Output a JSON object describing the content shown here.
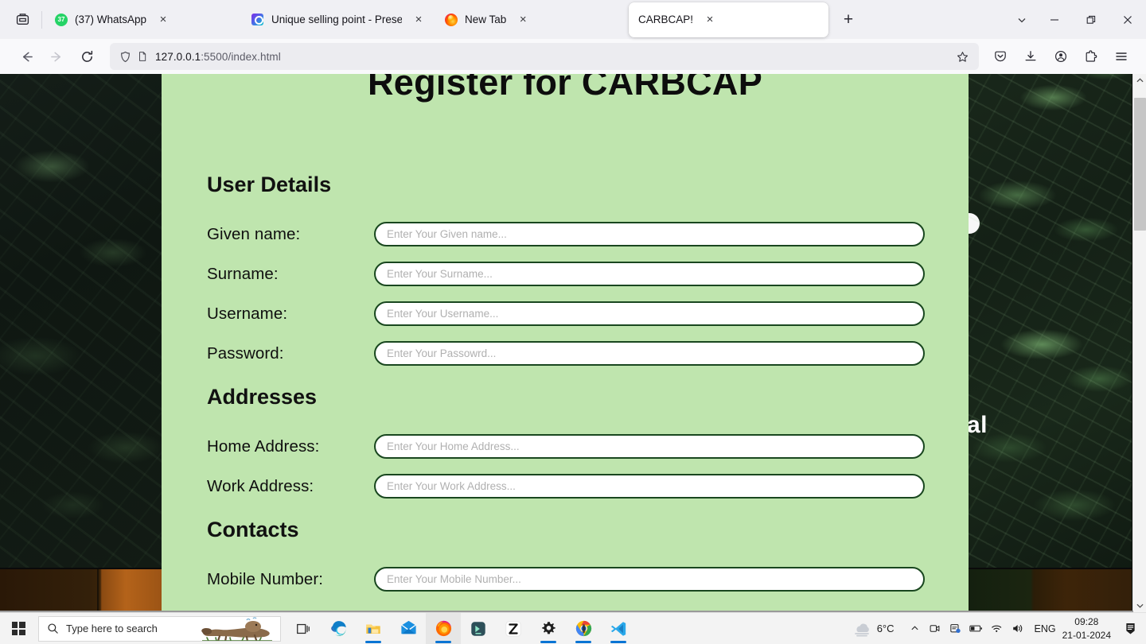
{
  "browser": {
    "firefox_view_tooltip": "Firefox View",
    "tabs": [
      {
        "title": "(37) WhatsApp",
        "favicon": "whatsapp-icon",
        "badge": "37",
        "active": false,
        "close_label": "×"
      },
      {
        "title": "Unique selling point - Presentat",
        "favicon": "canva-icon",
        "active": false,
        "close_label": "×"
      },
      {
        "title": "New Tab",
        "favicon": "firefox-icon",
        "active": false,
        "close_label": "×"
      },
      {
        "title": "CARBCAP!",
        "favicon": "none",
        "active": true,
        "close_label": "×"
      }
    ],
    "new_tab_label": "+",
    "window_controls": {
      "list_all_tabs": "list-all-tabs",
      "minimize": "minimize",
      "restore": "restore",
      "close": "close"
    },
    "nav": {
      "back": "back-arrow",
      "forward": "forward-arrow",
      "reload": "reload"
    },
    "urlbar": {
      "host": "127.0.0.1",
      "path": ":5500/index.html",
      "full_url": "127.0.0.1:5500/index.html",
      "shield_icon": "shield-icon",
      "page_icon": "page-icon",
      "bookmark_icon": "star-icon"
    },
    "toolbar_icons": [
      "pocket-icon",
      "downloads-icon",
      "account-icon",
      "extensions-icon",
      "app-menu-icon"
    ]
  },
  "page": {
    "title": "Register for CARBCAP",
    "sections": [
      {
        "heading": "User Details",
        "fields": [
          {
            "label": "Given name:",
            "placeholder": "Enter Your Given name...",
            "value": ""
          },
          {
            "label": "Surname:",
            "placeholder": "Enter Your Surname...",
            "value": ""
          },
          {
            "label": "Username:",
            "placeholder": "Enter Your Username...",
            "value": ""
          },
          {
            "label": "Password:",
            "placeholder": "Enter Your Passowrd...",
            "value": ""
          }
        ]
      },
      {
        "heading": "Addresses",
        "fields": [
          {
            "label": "Home Address:",
            "placeholder": "Enter Your Home Address...",
            "value": ""
          },
          {
            "label": "Work Address:",
            "placeholder": "Enter Your Work Address...",
            "value": ""
          }
        ]
      },
      {
        "heading": "Contacts",
        "fields": [
          {
            "label": "Mobile Number:",
            "placeholder": "Enter Your Mobile Number...",
            "value": ""
          }
        ]
      }
    ],
    "colors": {
      "background": "#bfe5ae",
      "input_border": "#19471f",
      "input_background": "#ffffff",
      "text": "#0f0f0f"
    }
  },
  "desktop": {
    "wallpaper_right_text": "al"
  },
  "scrollbar": {
    "up_arrow": "⌃",
    "down_arrow": "⌄"
  },
  "taskbar": {
    "start_label": "start-button",
    "search_placeholder": "Type here to search",
    "apps": [
      {
        "name": "task-view",
        "active": false,
        "running": false
      },
      {
        "name": "microsoft-edge",
        "active": false,
        "running": false
      },
      {
        "name": "file-explorer",
        "active": false,
        "running": true
      },
      {
        "name": "mail",
        "active": false,
        "running": false
      },
      {
        "name": "firefox",
        "active": true,
        "running": true
      },
      {
        "name": "terminal",
        "active": false,
        "running": false
      },
      {
        "name": "capcut",
        "active": false,
        "running": false
      },
      {
        "name": "settings",
        "active": false,
        "running": true
      },
      {
        "name": "google-chrome",
        "active": false,
        "running": true
      },
      {
        "name": "visual-studio-code",
        "active": false,
        "running": true
      }
    ],
    "weather": {
      "temperature": "6°C",
      "icon": "fog-icon"
    },
    "tray": {
      "chevron": "⌃",
      "icons": [
        "camera-icon",
        "teams-icon",
        "battery-icon",
        "wifi-icon",
        "volume-icon"
      ],
      "language": "ENG"
    },
    "clock": {
      "time": "09:28",
      "date": "21-01-2024"
    },
    "notifications": "notification-icon"
  }
}
